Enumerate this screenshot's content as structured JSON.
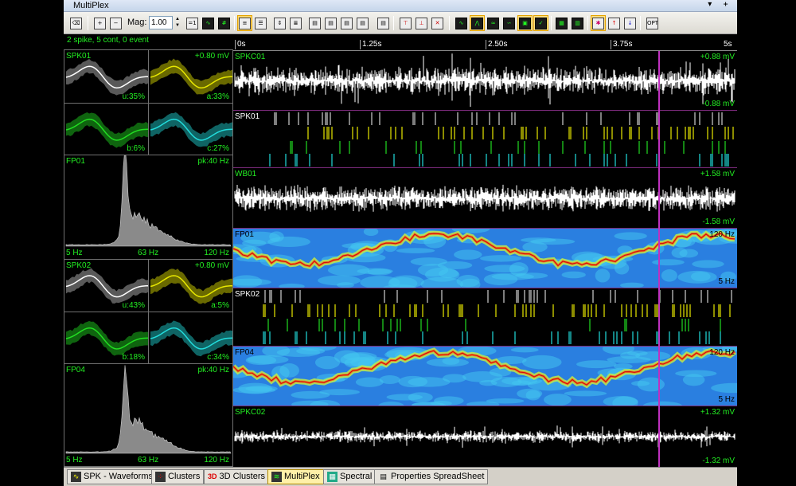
{
  "window": {
    "title": "MultiPlex",
    "controls": "▾ ᚐ"
  },
  "toolbar": {
    "mag_label": "Mag:",
    "mag_value": "1.00",
    "buttons": [
      {
        "id": "eraser",
        "icon": "eraser-icon",
        "glyph": "⌫"
      },
      {
        "id": "zoom-in",
        "icon": "zoom-in-icon",
        "glyph": "+"
      },
      {
        "id": "zoom-out",
        "icon": "zoom-out-icon",
        "glyph": "−"
      },
      {
        "id": "mag-reset",
        "icon": "mag-reset-icon",
        "glyph": "1"
      },
      {
        "id": "scope",
        "icon": "scope-icon",
        "glyph": "∿"
      },
      {
        "id": "grid",
        "icon": "grid-icon",
        "glyph": "#"
      }
    ]
  },
  "left": {
    "status": "2 spike, 5 cont, 0 event",
    "spk01": {
      "name": "SPK01",
      "range": "+0.80 mV",
      "u": "u:35%",
      "a": "a:33%",
      "b": "b:6%",
      "c": "c:27%"
    },
    "fp01": {
      "name": "FP01",
      "peak": "pk:40 Hz",
      "x1": "5 Hz",
      "x2": "63 Hz",
      "x3": "120 Hz"
    },
    "spk02": {
      "name": "SPK02",
      "range": "+0.80 mV",
      "u": "u:43%",
      "a": "a:5%",
      "b": "b:18%",
      "c": "c:34%"
    },
    "fp04": {
      "name": "FP04",
      "peak": "pk:40 Hz",
      "x1": "5 Hz",
      "x2": "63 Hz",
      "x3": "120 Hz"
    }
  },
  "timeline": {
    "ticks": [
      "0s",
      "1.25s",
      "2.50s",
      "3.75s",
      "5s"
    ]
  },
  "panels": {
    "spkc01": {
      "name": "SPKC01",
      "top": "+0.88 mV",
      "bottom": "-0.88 mV"
    },
    "spk01": {
      "name": "SPK01"
    },
    "wb01": {
      "name": "WB01",
      "top": "+1.58 mV",
      "bottom": "-1.58 mV"
    },
    "fp01": {
      "name": "FP01",
      "top": "120 Hz",
      "bottom": "5 Hz"
    },
    "spk02": {
      "name": "SPK02"
    },
    "fp04": {
      "name": "FP04",
      "top": "120 Hz",
      "bottom": "5 Hz"
    },
    "spkc02": {
      "name": "SPKC02",
      "top": "+1.32 mV",
      "bottom": "-1.32 mV"
    }
  },
  "tabs": [
    {
      "label": "SPK - Waveforms",
      "icon": "waveforms-icon"
    },
    {
      "label": "Clusters",
      "icon": "clusters-icon"
    },
    {
      "label": "3D Clusters",
      "icon": "3d-clusters-icon"
    },
    {
      "label": "MultiPlex",
      "icon": "multiplex-icon",
      "active": true
    },
    {
      "label": "Spectral",
      "icon": "spectral-icon"
    },
    {
      "label": "Properties SpreadSheet",
      "icon": "spreadsheet-icon"
    }
  ],
  "colors": {
    "unit_u": "#ffffff",
    "unit_a": "#e8e800",
    "unit_b": "#22dd22",
    "unit_c": "#22dddd",
    "label_green": "#22ee22",
    "cursor": "#c030c0",
    "spectrum_fill": "#8a8a8a"
  }
}
